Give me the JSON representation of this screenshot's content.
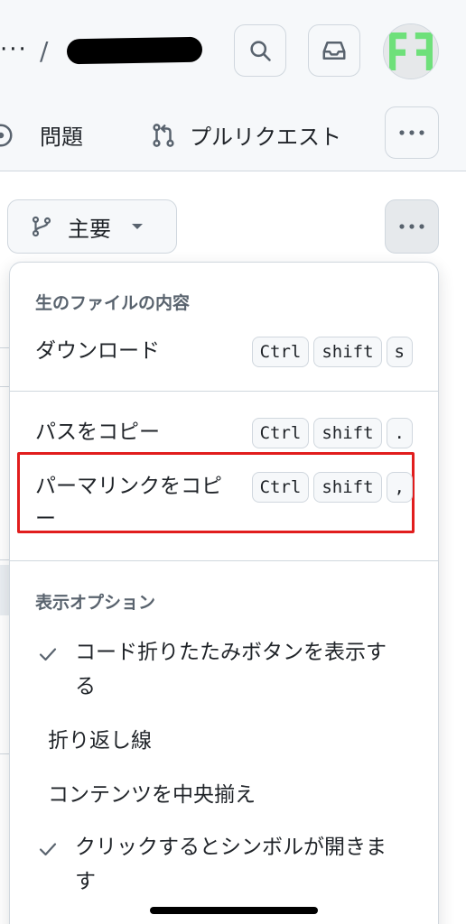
{
  "header": {
    "breadcrumb_dots": "···",
    "breadcrumb_slash": "/",
    "search_icon": "search-icon",
    "inbox_icon": "inbox-icon",
    "avatar_colors": {
      "fg": "#6ee07a",
      "bg": "#e6e8ea"
    }
  },
  "nav": {
    "issues_label": "問題",
    "pulls_label": "プルリクエスト",
    "more_icon": "kebab-horizontal-icon"
  },
  "branch": {
    "name": "主要",
    "icon": "git-branch-icon"
  },
  "menu": {
    "raw_group_title": "生のファイルの内容",
    "download": {
      "label": "ダウンロード",
      "keys": [
        "Ctrl",
        "shift",
        "s"
      ]
    },
    "copy_path": {
      "label": "パスをコピー",
      "keys": [
        "Ctrl",
        "shift",
        "."
      ]
    },
    "copy_permalink": {
      "label_line1": "パーマリンクをコピ",
      "label_line2": "ー",
      "keys": [
        "Ctrl",
        "shift",
        ","
      ]
    },
    "view_group_title": "表示オプション",
    "options": [
      {
        "line1": "コード折りたたみボタンを表示す",
        "line2": "る",
        "checked": true
      },
      {
        "line1": "折り返し線",
        "line2": "",
        "checked": false
      },
      {
        "line1": "コンテンツを中央揃え",
        "line2": "",
        "checked": false
      },
      {
        "line1": "クリックするとシンボルが開きま",
        "line2": "す",
        "checked": true
      }
    ]
  },
  "colors": {
    "highlight": "#e11d1d",
    "border": "#d0d7de",
    "header_bg": "#f6f8fa"
  }
}
